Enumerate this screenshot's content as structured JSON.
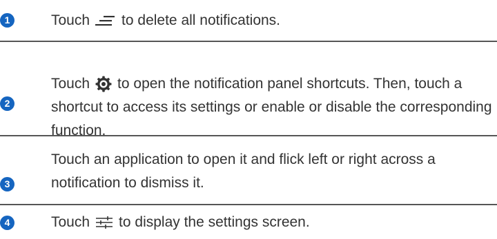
{
  "steps": [
    {
      "number": "1",
      "before": "Touch",
      "icon": "clear-all-icon",
      "after": "to delete all notifications."
    },
    {
      "number": "2",
      "before": "Touch",
      "icon": "settings-gear-icon",
      "after_line1": "to open the notification panel shortcuts. Then, touch a",
      "line2": "shortcut to access its settings or enable or disable the corresponding",
      "line3": "function."
    },
    {
      "number": "3",
      "line1": "Touch an application to open it and flick left or right across a",
      "line2": "notification to dismiss it."
    },
    {
      "number": "4",
      "before": "Touch",
      "icon": "sliders-icon",
      "after": "to display the settings screen."
    }
  ],
  "colors": {
    "badge": "#1565c0",
    "text": "#333333",
    "divider": "#555555"
  }
}
